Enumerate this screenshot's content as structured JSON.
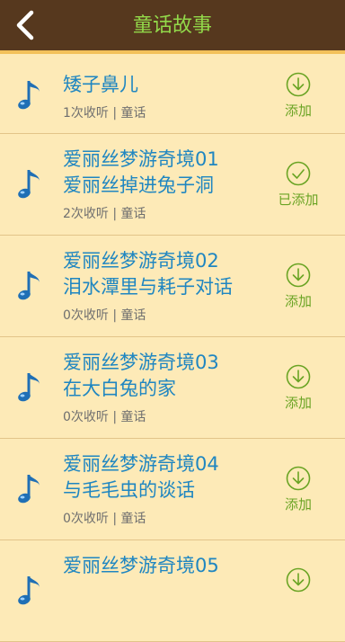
{
  "header": {
    "title": "童话故事",
    "back_icon": "chevron-left-icon"
  },
  "colors": {
    "header_bg": "#56381e",
    "title_green": "#92d94a",
    "accent_orange": "#f3c15a",
    "list_bg": "#fdeab7",
    "item_title_blue": "#1f86c1",
    "add_green": "#6aa424"
  },
  "stories": [
    {
      "title1": "矮子鼻儿",
      "title2": "",
      "meta": "1次收听 | 童话",
      "action": "添加",
      "action_icon": "download-circle-icon"
    },
    {
      "title1": "爱丽丝梦游奇境01",
      "title2": "爱丽丝掉进兔子洞",
      "meta": "2次收听 | 童话",
      "action": "已添加",
      "action_icon": "check-circle-icon"
    },
    {
      "title1": "爱丽丝梦游奇境02",
      "title2": "泪水潭里与耗子对话",
      "meta": "0次收听 | 童话",
      "action": "添加",
      "action_icon": "download-circle-icon"
    },
    {
      "title1": "爱丽丝梦游奇境03",
      "title2": "在大白兔的家",
      "meta": "0次收听 | 童话",
      "action": "添加",
      "action_icon": "download-circle-icon"
    },
    {
      "title1": "爱丽丝梦游奇境04",
      "title2": "与毛毛虫的谈话",
      "meta": "0次收听 | 童话",
      "action": "添加",
      "action_icon": "download-circle-icon"
    },
    {
      "title1": "爱丽丝梦游奇境05",
      "title2": "",
      "meta": "",
      "action": "",
      "action_icon": "download-circle-icon"
    }
  ]
}
